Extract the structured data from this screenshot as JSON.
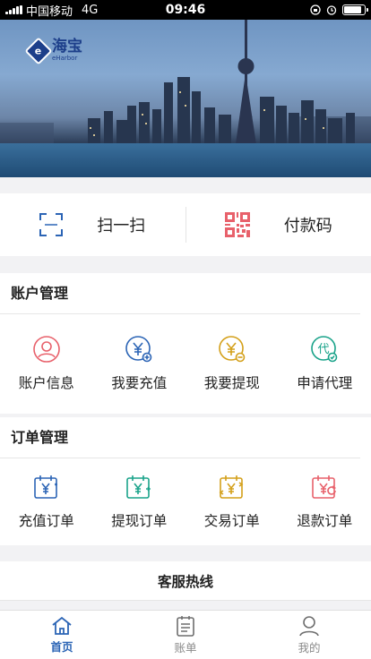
{
  "status_bar": {
    "carrier": "中国移动",
    "network": "4G",
    "time": "09:46"
  },
  "banner": {
    "logo_text": "海宝",
    "logo_subtext": "eHarbor"
  },
  "quick_actions": [
    {
      "label": "扫一扫",
      "icon": "scan-icon",
      "color": "#2b64b5"
    },
    {
      "label": "付款码",
      "icon": "qrcode-icon",
      "color": "#e8616b"
    }
  ],
  "account": {
    "title": "账户管理",
    "items": [
      {
        "label": "账户信息",
        "icon": "user-icon",
        "color": "#e8616b"
      },
      {
        "label": "我要充值",
        "icon": "yuan-plus-icon",
        "color": "#2b64b5"
      },
      {
        "label": "我要提现",
        "icon": "yuan-minus-icon",
        "color": "#d4a01a"
      },
      {
        "label": "申请代理",
        "icon": "agent-icon",
        "color": "#1aa38a"
      }
    ]
  },
  "orders": {
    "title": "订单管理",
    "items": [
      {
        "label": "充值订单",
        "icon": "recharge-order-icon",
        "color": "#2b64b5"
      },
      {
        "label": "提现订单",
        "icon": "withdraw-order-icon",
        "color": "#1aa38a"
      },
      {
        "label": "交易订单",
        "icon": "trade-order-icon",
        "color": "#d4a01a"
      },
      {
        "label": "退款订单",
        "icon": "refund-order-icon",
        "color": "#e8616b"
      }
    ]
  },
  "hotline": {
    "label": "客服热线"
  },
  "tabbar": [
    {
      "label": "首页",
      "icon": "home-icon",
      "active": true
    },
    {
      "label": "账单",
      "icon": "bill-icon",
      "active": false
    },
    {
      "label": "我的",
      "icon": "profile-icon",
      "active": false
    }
  ]
}
